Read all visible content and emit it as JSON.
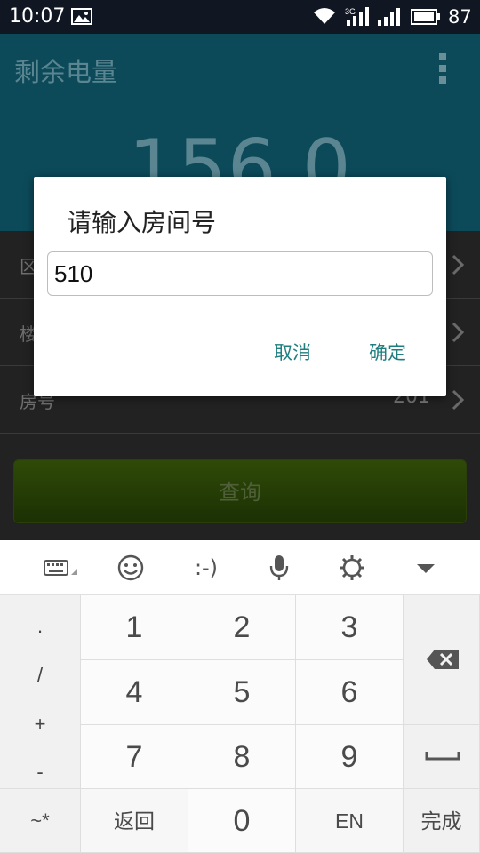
{
  "status_bar": {
    "time": "10:07",
    "battery": "87",
    "network_label": "3G"
  },
  "header": {
    "title": "剩余电量",
    "value": "156.0"
  },
  "form": {
    "rows": [
      {
        "label": "区",
        "value": ""
      },
      {
        "label": "楼",
        "value": ""
      },
      {
        "label": "房号",
        "value": "201"
      }
    ],
    "query_button": "查询"
  },
  "dialog": {
    "title": "请输入房间号",
    "input_value": "510",
    "cancel_label": "取消",
    "ok_label": "确定"
  },
  "keyboard": {
    "toolbar": {
      "emoticon_text": ":-)"
    },
    "symbols": [
      ".",
      "/",
      "+",
      "-"
    ],
    "digits": [
      "1",
      "2",
      "3",
      "4",
      "5",
      "6",
      "7",
      "8",
      "9",
      "0"
    ],
    "bottom": {
      "special": "~*",
      "back": "返回",
      "lang": "EN",
      "done": "完成"
    }
  },
  "colors": {
    "accent": "#1f7f80",
    "header_bg": "#0c4a5a",
    "button_green": "#2f4a08"
  }
}
